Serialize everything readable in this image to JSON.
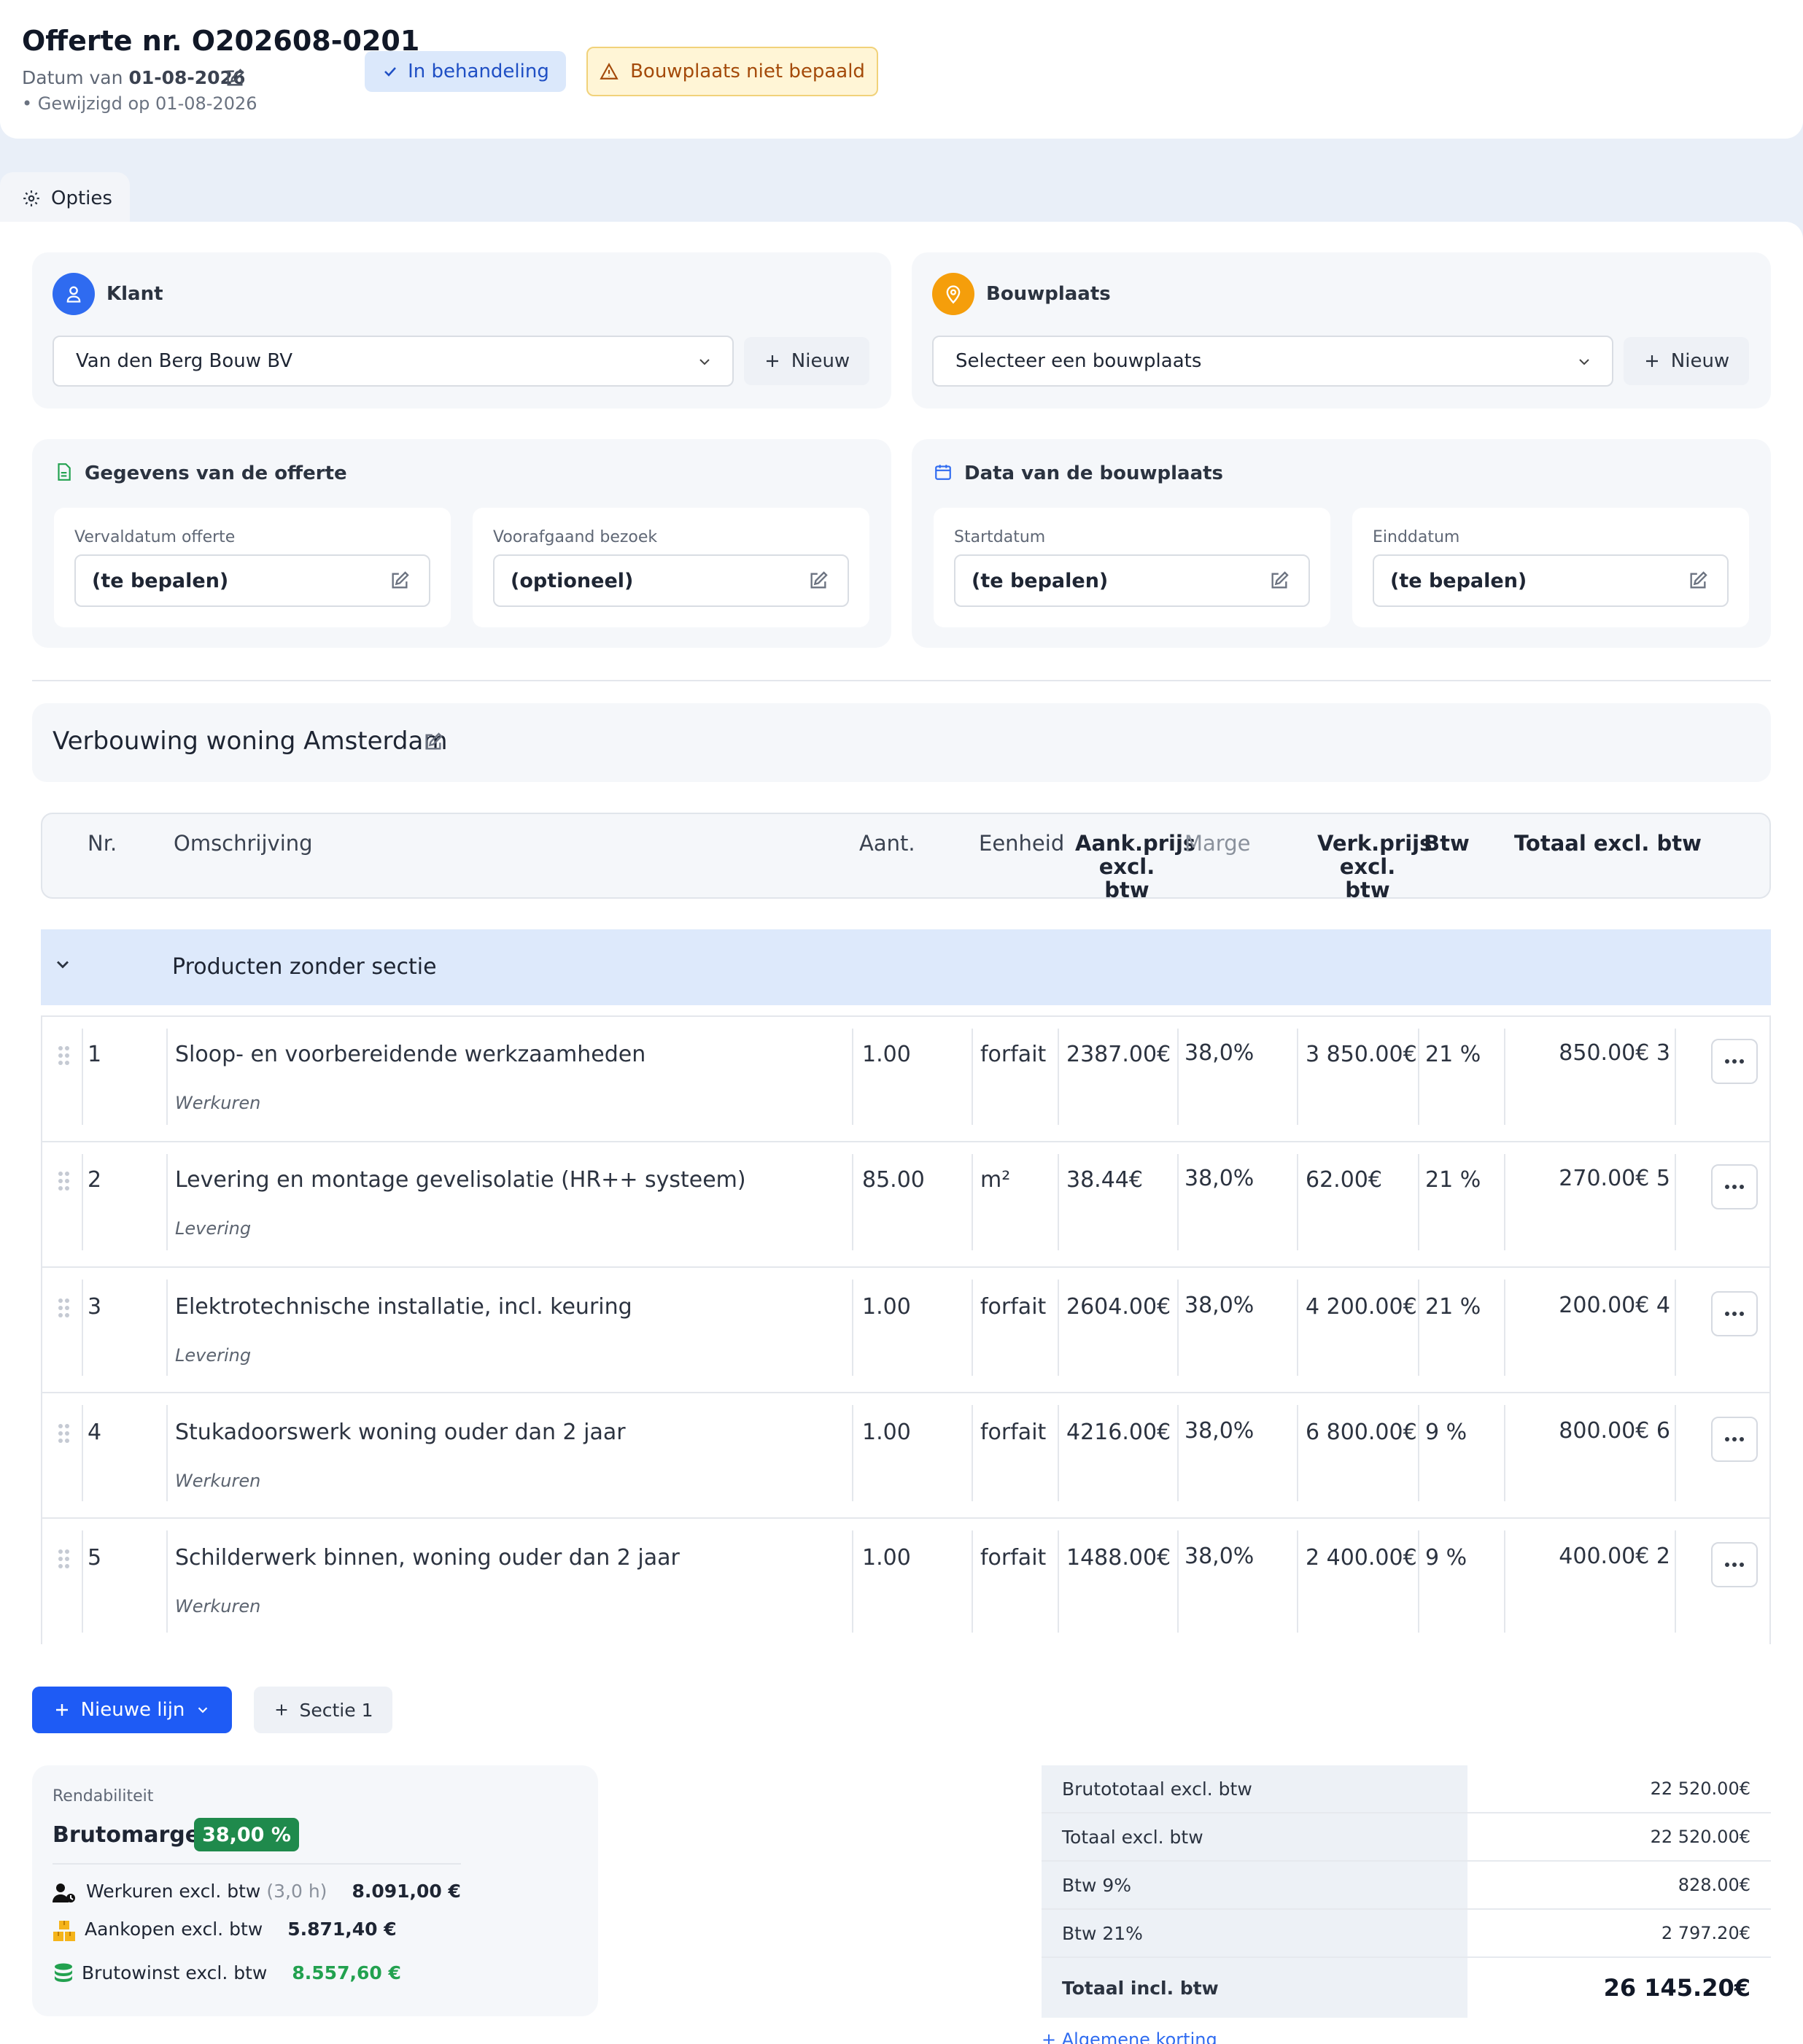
{
  "header": {
    "title": "Offerte nr. O202608-0201",
    "date_prefix": "Datum van",
    "date": "01-08-2026",
    "modified": "• Gewijzigd op 01-08-2026",
    "status": "In behandeling",
    "warning": "Bouwplaats niet bepaald"
  },
  "options_tab": "Opties",
  "klant": {
    "title": "Klant",
    "value": "Van den Berg Bouw BV",
    "new_label": "Nieuw"
  },
  "bouwplaats": {
    "title": "Bouwplaats",
    "placeholder": "Selecteer een bouwplaats",
    "new_label": "Nieuw"
  },
  "gegevens": {
    "title": "Gegevens van de offerte",
    "vervaldatum_label": "Vervaldatum offerte",
    "vervaldatum_value": "(te bepalen)",
    "bezoek_label": "Voorafgaand bezoek",
    "bezoek_value": "(optioneel)"
  },
  "data_bouwplaats": {
    "title": "Data van de bouwplaats",
    "start_label": "Startdatum",
    "start_value": "(te bepalen)",
    "eind_label": "Einddatum",
    "eind_value": "(te bepalen)"
  },
  "project_title": "Verbouwing woning Amsterdam",
  "table": {
    "headers": {
      "nr": "Nr.",
      "omschrijving": "Omschrijving",
      "aant": "Aant.",
      "eenheid": "Eenheid",
      "aank1": "Aank.prijs",
      "aank2": "excl. btw",
      "marge": "Marge",
      "verk1": "Verk.prijs",
      "verk2": "excl. btw",
      "btw": "Btw",
      "totaal": "Totaal excl. btw"
    },
    "section": "Producten zonder sectie",
    "rows": [
      {
        "nr": "1",
        "desc": "Sloop- en voorbereidende werkzaamheden",
        "sub": "Werkuren",
        "aant": "1.00",
        "eenheid": "forfait",
        "aank": "2387.00€",
        "marge": "38,0%",
        "verk": "3 850.00€",
        "btw": "21 %",
        "totaal": "3 850.00€"
      },
      {
        "nr": "2",
        "desc": "Levering en montage gevelisolatie (HR++ systeem)",
        "sub": "Levering",
        "aant": "85.00",
        "eenheid": "m²",
        "aank": "38.44€",
        "marge": "38,0%",
        "verk": "62.00€",
        "btw": "21 %",
        "totaal": "5 270.00€"
      },
      {
        "nr": "3",
        "desc": "Elektrotechnische installatie, incl. keuring",
        "sub": "Levering",
        "aant": "1.00",
        "eenheid": "forfait",
        "aank": "2604.00€",
        "marge": "38,0%",
        "verk": "4 200.00€",
        "btw": "21 %",
        "totaal": "4 200.00€"
      },
      {
        "nr": "4",
        "desc": "Stukadoorswerk woning ouder dan 2 jaar",
        "sub": "Werkuren",
        "aant": "1.00",
        "eenheid": "forfait",
        "aank": "4216.00€",
        "marge": "38,0%",
        "verk": "6 800.00€",
        "btw": "9 %",
        "totaal": "6 800.00€"
      },
      {
        "nr": "5",
        "desc": "Schilderwerk binnen, woning ouder dan 2 jaar",
        "sub": "Werkuren",
        "aant": "1.00",
        "eenheid": "forfait",
        "aank": "1488.00€",
        "marge": "38,0%",
        "verk": "2 400.00€",
        "btw": "9 %",
        "totaal": "2 400.00€"
      }
    ]
  },
  "actions": {
    "new_line": "Nieuwe lijn",
    "section": "Sectie 1"
  },
  "rendabiliteit": {
    "title": "Rendabiliteit",
    "brutomarge_label": "Brutomarge",
    "brutomarge_value": "38,00 %",
    "werkuren_label": "Werkuren excl. btw",
    "werkuren_hours": "(3,0 h)",
    "werkuren_value": "8.091,00 €",
    "aankopen_label": "Aankopen excl. btw",
    "aankopen_value": "5.871,40 €",
    "brutowinst_label": "Brutowinst excl. btw",
    "brutowinst_value": "8.557,60 €"
  },
  "totals": [
    {
      "label": "Brutototaal excl. btw",
      "value": "22 520.00€"
    },
    {
      "label": "Totaal excl. btw",
      "value": "22 520.00€"
    },
    {
      "label": "Btw 9%",
      "value": "828.00€"
    },
    {
      "label": "Btw 21%",
      "value": "2 797.20€"
    },
    {
      "label": "Totaal incl. btw",
      "value": "26 145.20€"
    }
  ],
  "discount_link": "+ Algemene korting",
  "colors": {
    "primary": "#1e5bf5",
    "green": "#22a14f",
    "badge_green": "#1f8a4c",
    "status_bg": "#dbe8fb",
    "warning_bg": "#fff5d6",
    "section_bg": "#dde9fb"
  }
}
